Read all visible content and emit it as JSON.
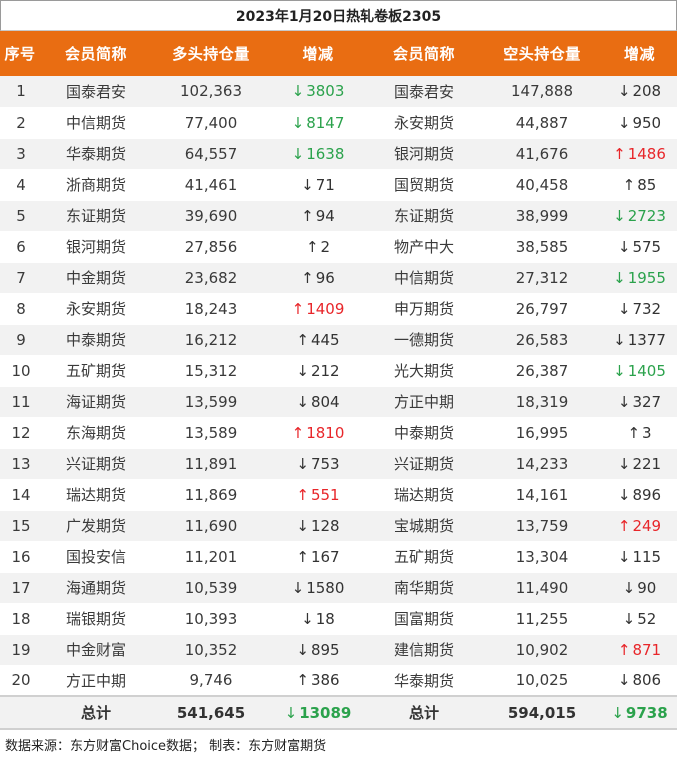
{
  "title": "2023年1月20日热轧卷板2305",
  "headers": [
    "序号",
    "会员简称",
    "多头持仓量",
    "增减",
    "会员简称",
    "空头持仓量",
    "增减"
  ],
  "rows": [
    {
      "rank": "1",
      "long_member": "国泰君安",
      "long_pos": "102,363",
      "long_chg": "3803",
      "long_dir": "down",
      "long_color": "green",
      "short_member": "国泰君安",
      "short_pos": "147,888",
      "short_chg": "208",
      "short_dir": "down",
      "short_color": "neutral"
    },
    {
      "rank": "2",
      "long_member": "中信期货",
      "long_pos": "77,400",
      "long_chg": "8147",
      "long_dir": "down",
      "long_color": "green",
      "short_member": "永安期货",
      "short_pos": "44,887",
      "short_chg": "950",
      "short_dir": "down",
      "short_color": "neutral"
    },
    {
      "rank": "3",
      "long_member": "华泰期货",
      "long_pos": "64,557",
      "long_chg": "1638",
      "long_dir": "down",
      "long_color": "green",
      "short_member": "银河期货",
      "short_pos": "41,676",
      "short_chg": "1486",
      "short_dir": "up",
      "short_color": "red"
    },
    {
      "rank": "4",
      "long_member": "浙商期货",
      "long_pos": "41,461",
      "long_chg": "71",
      "long_dir": "down",
      "long_color": "neutral",
      "short_member": "国贸期货",
      "short_pos": "40,458",
      "short_chg": "85",
      "short_dir": "up",
      "short_color": "neutral"
    },
    {
      "rank": "5",
      "long_member": "东证期货",
      "long_pos": "39,690",
      "long_chg": "94",
      "long_dir": "up",
      "long_color": "neutral",
      "short_member": "东证期货",
      "short_pos": "38,999",
      "short_chg": "2723",
      "short_dir": "down",
      "short_color": "green"
    },
    {
      "rank": "6",
      "long_member": "银河期货",
      "long_pos": "27,856",
      "long_chg": "2",
      "long_dir": "up",
      "long_color": "neutral",
      "short_member": "物产中大",
      "short_pos": "38,585",
      "short_chg": "575",
      "short_dir": "down",
      "short_color": "neutral"
    },
    {
      "rank": "7",
      "long_member": "中金期货",
      "long_pos": "23,682",
      "long_chg": "96",
      "long_dir": "up",
      "long_color": "neutral",
      "short_member": "中信期货",
      "short_pos": "27,312",
      "short_chg": "1955",
      "short_dir": "down",
      "short_color": "green"
    },
    {
      "rank": "8",
      "long_member": "永安期货",
      "long_pos": "18,243",
      "long_chg": "1409",
      "long_dir": "up",
      "long_color": "red",
      "short_member": "申万期货",
      "short_pos": "26,797",
      "short_chg": "732",
      "short_dir": "down",
      "short_color": "neutral"
    },
    {
      "rank": "9",
      "long_member": "中泰期货",
      "long_pos": "16,212",
      "long_chg": "445",
      "long_dir": "up",
      "long_color": "neutral",
      "short_member": "一德期货",
      "short_pos": "26,583",
      "short_chg": "1377",
      "short_dir": "down",
      "short_color": "neutral"
    },
    {
      "rank": "10",
      "long_member": "五矿期货",
      "long_pos": "15,312",
      "long_chg": "212",
      "long_dir": "down",
      "long_color": "neutral",
      "short_member": "光大期货",
      "short_pos": "26,387",
      "short_chg": "1405",
      "short_dir": "down",
      "short_color": "green"
    },
    {
      "rank": "11",
      "long_member": "海证期货",
      "long_pos": "13,599",
      "long_chg": "804",
      "long_dir": "down",
      "long_color": "neutral",
      "short_member": "方正中期",
      "short_pos": "18,319",
      "short_chg": "327",
      "short_dir": "down",
      "short_color": "neutral"
    },
    {
      "rank": "12",
      "long_member": "东海期货",
      "long_pos": "13,589",
      "long_chg": "1810",
      "long_dir": "up",
      "long_color": "red",
      "short_member": "中泰期货",
      "short_pos": "16,995",
      "short_chg": "3",
      "short_dir": "up",
      "short_color": "neutral"
    },
    {
      "rank": "13",
      "long_member": "兴证期货",
      "long_pos": "11,891",
      "long_chg": "753",
      "long_dir": "down",
      "long_color": "neutral",
      "short_member": "兴证期货",
      "short_pos": "14,233",
      "short_chg": "221",
      "short_dir": "down",
      "short_color": "neutral"
    },
    {
      "rank": "14",
      "long_member": "瑞达期货",
      "long_pos": "11,869",
      "long_chg": "551",
      "long_dir": "up",
      "long_color": "red",
      "short_member": "瑞达期货",
      "short_pos": "14,161",
      "short_chg": "896",
      "short_dir": "down",
      "short_color": "neutral"
    },
    {
      "rank": "15",
      "long_member": "广发期货",
      "long_pos": "11,690",
      "long_chg": "128",
      "long_dir": "down",
      "long_color": "neutral",
      "short_member": "宝城期货",
      "short_pos": "13,759",
      "short_chg": "249",
      "short_dir": "up",
      "short_color": "red"
    },
    {
      "rank": "16",
      "long_member": "国投安信",
      "long_pos": "11,201",
      "long_chg": "167",
      "long_dir": "up",
      "long_color": "neutral",
      "short_member": "五矿期货",
      "short_pos": "13,304",
      "short_chg": "115",
      "short_dir": "down",
      "short_color": "neutral"
    },
    {
      "rank": "17",
      "long_member": "海通期货",
      "long_pos": "10,539",
      "long_chg": "1580",
      "long_dir": "down",
      "long_color": "neutral",
      "short_member": "南华期货",
      "short_pos": "11,490",
      "short_chg": "90",
      "short_dir": "down",
      "short_color": "neutral"
    },
    {
      "rank": "18",
      "long_member": "瑞银期货",
      "long_pos": "10,393",
      "long_chg": "18",
      "long_dir": "down",
      "long_color": "neutral",
      "short_member": "国富期货",
      "short_pos": "11,255",
      "short_chg": "52",
      "short_dir": "down",
      "short_color": "neutral"
    },
    {
      "rank": "19",
      "long_member": "中金财富",
      "long_pos": "10,352",
      "long_chg": "895",
      "long_dir": "down",
      "long_color": "neutral",
      "short_member": "建信期货",
      "short_pos": "10,902",
      "short_chg": "871",
      "short_dir": "up",
      "short_color": "red"
    },
    {
      "rank": "20",
      "long_member": "方正中期",
      "long_pos": "9,746",
      "long_chg": "386",
      "long_dir": "up",
      "long_color": "neutral",
      "short_member": "华泰期货",
      "short_pos": "10,025",
      "short_chg": "806",
      "short_dir": "down",
      "short_color": "neutral"
    }
  ],
  "totals": {
    "label_long": "总计",
    "long_pos": "541,645",
    "long_chg": "13089",
    "long_dir": "down",
    "label_short": "总计",
    "short_pos": "594,015",
    "short_chg": "9738",
    "short_dir": "down"
  },
  "source": "数据来源：东方财富Choice数据；  制表：东方财富期货",
  "colors": {
    "header_bg": "#e96d12",
    "up": "#e8262a",
    "down": "#2ba24c",
    "stripe": "#f2f2f2"
  }
}
